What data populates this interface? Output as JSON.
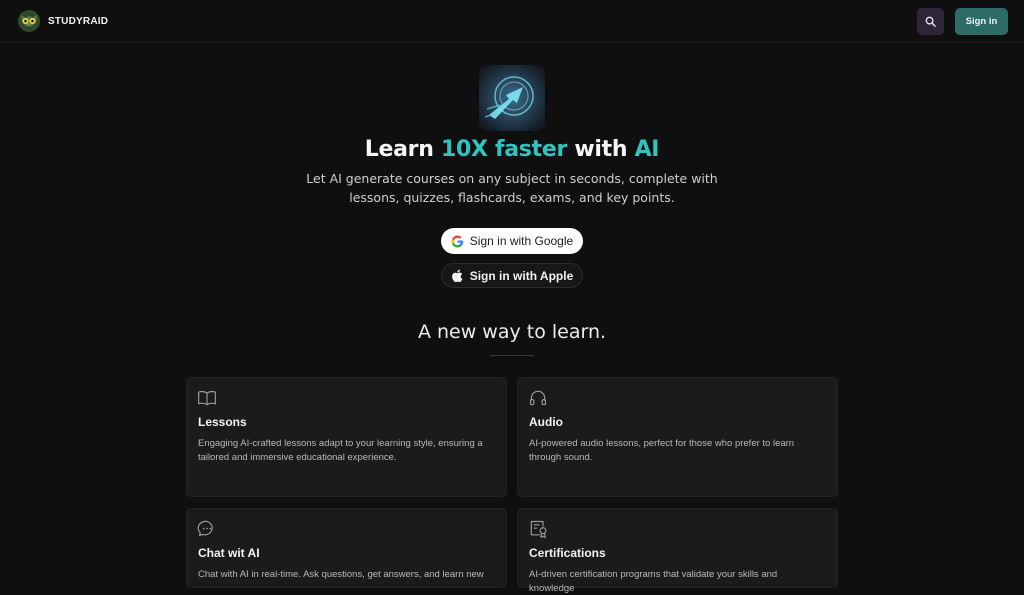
{
  "header": {
    "brand": "STUDYRAID",
    "signin_label": "Sign in"
  },
  "hero": {
    "title_parts": [
      "Learn ",
      "10X faster",
      " with ",
      "AI"
    ],
    "subtitle": "Let AI generate courses on any subject in seconds, complete with lessons, quizzes, flashcards, exams, and key points.",
    "google_label": "Sign in with Google",
    "apple_label": "Sign in with Apple"
  },
  "section": {
    "title": "A new way to learn."
  },
  "features": [
    {
      "icon": "book-icon",
      "title": "Lessons",
      "desc": "Engaging AI-crafted lessons adapt to your learning style, ensuring a tailored and immersive educational experience."
    },
    {
      "icon": "headphones-icon",
      "title": "Audio",
      "desc": "AI-powered audio lessons, perfect for those who prefer to learn through sound."
    },
    {
      "icon": "chat-icon",
      "title": "Chat wit AI",
      "desc": "Chat with AI in real-time. Ask questions, get answers, and learn new"
    },
    {
      "icon": "certificate-icon",
      "title": "Certifications",
      "desc": "AI-driven certification programs that validate your skills and knowledge"
    }
  ],
  "colors": {
    "background": "#0f0f10",
    "accent": "#2ec4c0",
    "signin_button": "#2d6b66",
    "search_button": "#2e2638",
    "card": "#1b1b1e"
  }
}
